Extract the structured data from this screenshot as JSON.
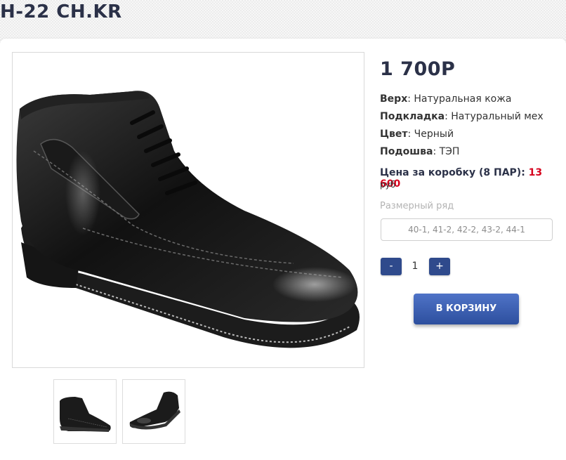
{
  "product": {
    "title": "H-22 CH.KR",
    "price": "1 700Р",
    "specs": [
      {
        "key": "Верх",
        "value": "Натуральная кожа"
      },
      {
        "key": "Подкладка",
        "value": "Натуральный мех"
      },
      {
        "key": "Цвет",
        "value": "Черный"
      },
      {
        "key": "Подошва",
        "value": "ТЭП"
      }
    ],
    "box_price": {
      "label": "Цена за коробку (8 ПАР):",
      "value": "13 600",
      "unit": "руб"
    },
    "sizes": {
      "label": "Размерный ряд",
      "value": "40-1, 41-2, 42-2, 43-2, 44-1"
    },
    "quantity": {
      "minus": "-",
      "value": "1",
      "plus": "+"
    },
    "cart_button": "В КОРЗИНУ",
    "images": {
      "main": "black-leather-ankle-boot-photo",
      "thumbnails": [
        "boot-side-view",
        "boot-angle-view"
      ]
    }
  },
  "colors": {
    "accent": "#2f4a8c",
    "title": "#2b3148",
    "box_price_value": "#d6001c"
  }
}
